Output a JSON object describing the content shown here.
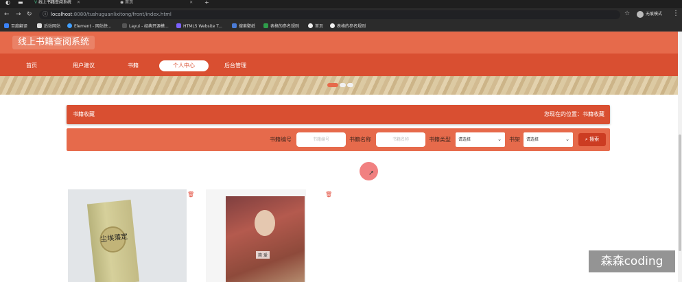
{
  "browser": {
    "tabs": [
      {
        "title": "线上书籍查阅系统",
        "active": true
      },
      {
        "title": "首页",
        "active": false
      }
    ],
    "new_tab": "+",
    "url_host": "localhost",
    "url_path": ":8080/tushuguanlixitong/front/index.html",
    "profile_label": "无痕模式",
    "bookmarks": [
      "百度翻译",
      "后站网站",
      "Element - 网站快...",
      "Layui - 经典开源模...",
      "HTML5 Website T...",
      "搜索壁纸",
      "表格的参名规则",
      "首页",
      "表格的参名规则"
    ]
  },
  "site": {
    "title": "线上书籍查阅系统",
    "nav": [
      "首页",
      "用户建议",
      "书籍",
      "个人中心",
      "后台管理"
    ],
    "active_nav_index": 3
  },
  "section": {
    "title": "书籍收藏",
    "breadcrumb": "您现在的位置：书籍收藏"
  },
  "search": {
    "book_no_label": "书籍编号",
    "book_no_placeholder": "书籍编号",
    "book_name_label": "书籍名称",
    "book_name_placeholder": "书籍名称",
    "book_type_label": "书籍类型",
    "book_type_value": "请选择",
    "shelf_label": "书架",
    "shelf_value": "请选择",
    "button_label": "搜索"
  },
  "books": [
    {
      "cover_text": "尘埃落定"
    },
    {
      "cover_text": "简 爱"
    }
  ],
  "watermark": "森森coding",
  "colors": {
    "header": "#e66a4b",
    "nav": "#d94f31",
    "accent": "#cc3c22"
  }
}
